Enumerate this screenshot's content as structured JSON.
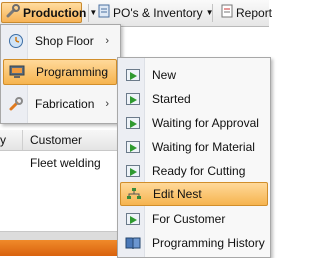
{
  "toolbar": {
    "production_label": "Production",
    "pos_inventory_label": "PO's & Inventory",
    "reports_label": "Report"
  },
  "grid": {
    "header_truncated": "y",
    "customer_header": "Customer",
    "row1_customer": "Fleet welding"
  },
  "menu_production": {
    "items": [
      {
        "label": "Shop Floor",
        "icon": "clock-gear-icon",
        "arrow": "›"
      },
      {
        "label": "Programming",
        "icon": "monitor-icon",
        "arrow": "›"
      },
      {
        "label": "Fabrication",
        "icon": "wrench-icon",
        "arrow": "›"
      }
    ]
  },
  "menu_programming": {
    "items": [
      {
        "label": "New",
        "icon": "status-arrow-icon"
      },
      {
        "label": "Started",
        "icon": "status-arrow-icon"
      },
      {
        "label": "Waiting for Approval",
        "icon": "status-arrow-icon"
      },
      {
        "label": "Waiting for Material",
        "icon": "status-arrow-icon"
      },
      {
        "label": "Ready for Cutting",
        "icon": "status-arrow-icon"
      },
      {
        "label": "Edit Nest",
        "icon": "nest-icon"
      },
      {
        "label": "For Customer",
        "icon": "status-arrow-icon"
      },
      {
        "label": "Programming History",
        "icon": "book-icon"
      }
    ]
  },
  "colors": {
    "highlight": "#f6b44f",
    "accent_orange": "#e06f18"
  }
}
